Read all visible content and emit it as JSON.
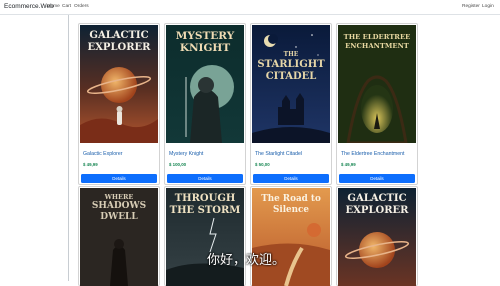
{
  "navbar": {
    "brand": "Ecommerce.Web",
    "links": [
      "Home",
      "Cart",
      "Orders"
    ],
    "register": "Register",
    "login": "Login"
  },
  "products": [
    {
      "cover_lines": [
        "GALACTIC",
        "EXPLORER"
      ],
      "title": "Galactic Explorer",
      "price": "$ 49,99",
      "button": "Details"
    },
    {
      "cover_lines": [
        "MYSTERY",
        "KNIGHT"
      ],
      "title": "Mystery Knight",
      "price": "$ 100,00",
      "button": "Details"
    },
    {
      "cover_lines": [
        "THE",
        "STARLIGHT",
        "CITADEL"
      ],
      "title": "The Starlight Citadel",
      "price": "$ 50,00",
      "button": "Details"
    },
    {
      "cover_lines": [
        "THE ELDERTREE",
        "ENCHANTMENT"
      ],
      "title": "The Eldertree Enchantment",
      "price": "$ 49,99",
      "button": "Details"
    },
    {
      "cover_lines": [
        "WHERE",
        "SHADOWS",
        "DWELL"
      ]
    },
    {
      "cover_lines": [
        "THROUGH",
        "THE STORM"
      ]
    },
    {
      "cover_lines": [
        "The Road to",
        "Silence"
      ]
    },
    {
      "cover_lines": [
        "GALACTIC",
        "EXPLORER"
      ]
    }
  ],
  "overlay_subtitle": "你好，欢迎。",
  "colors": {
    "primary": "#0d6efd",
    "price": "#198754",
    "title": "#1a5eab"
  }
}
